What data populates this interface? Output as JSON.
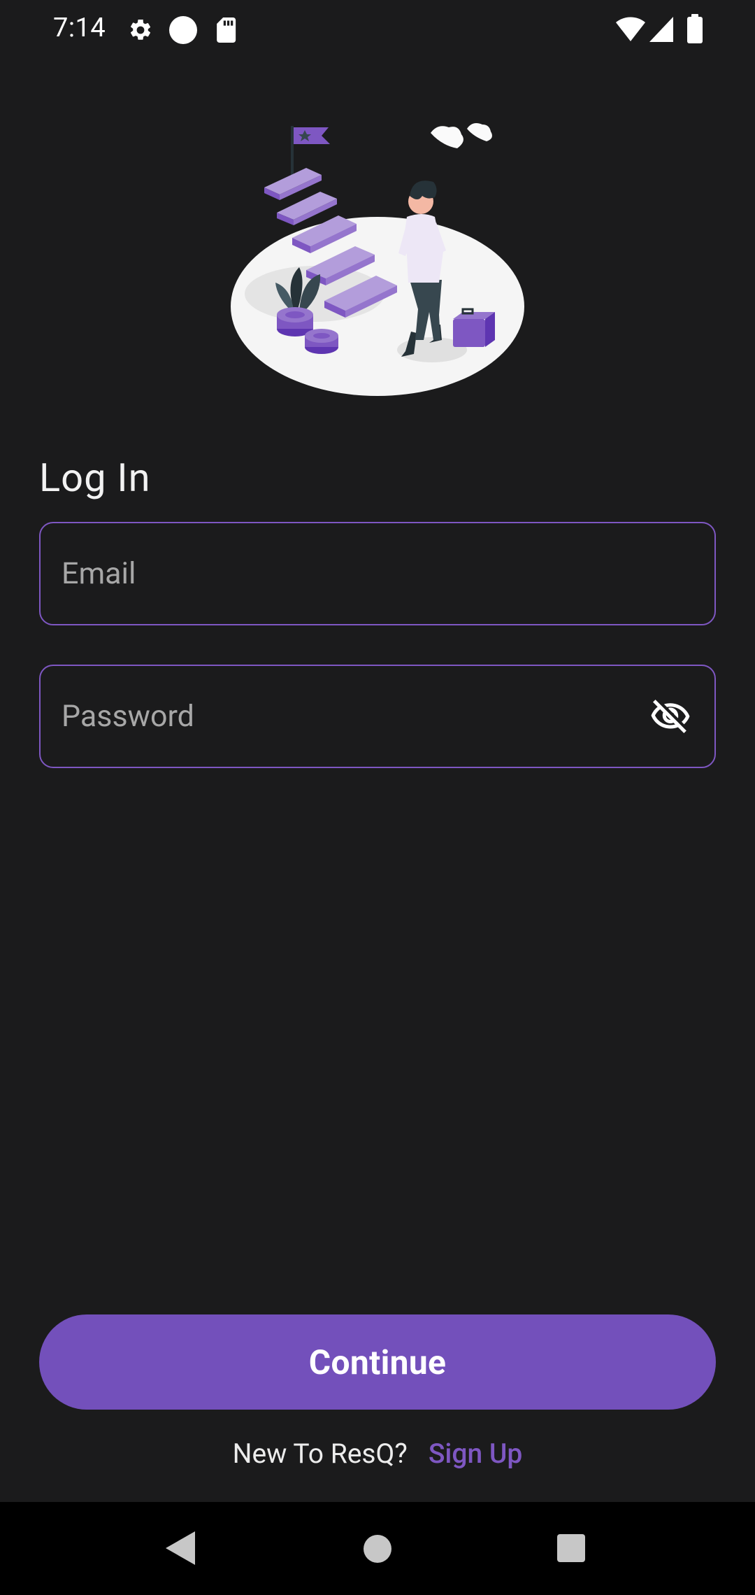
{
  "status_bar": {
    "time": "7:14",
    "icons": [
      "settings-icon",
      "circle-notification-icon",
      "sd-card-icon",
      "wifi-icon",
      "cellular-signal-icon",
      "battery-icon"
    ]
  },
  "illustration": {
    "description_icon": "career-steps-illustration",
    "accent_color": "#7e57c2"
  },
  "login": {
    "title": "Log In",
    "email_placeholder": "Email",
    "email_value": "",
    "password_placeholder": "Password",
    "password_value": "",
    "visibility_icon": "eye-off-icon"
  },
  "actions": {
    "continue_label": "Continue",
    "signup_prompt": "New To ResQ?",
    "signup_link": "Sign Up"
  },
  "colors": {
    "background": "#1b1b1c",
    "accent": "#7e57c2",
    "button": "#7350bb"
  },
  "nav_bar": {
    "icons": [
      "back-icon",
      "home-icon",
      "recents-icon"
    ]
  }
}
